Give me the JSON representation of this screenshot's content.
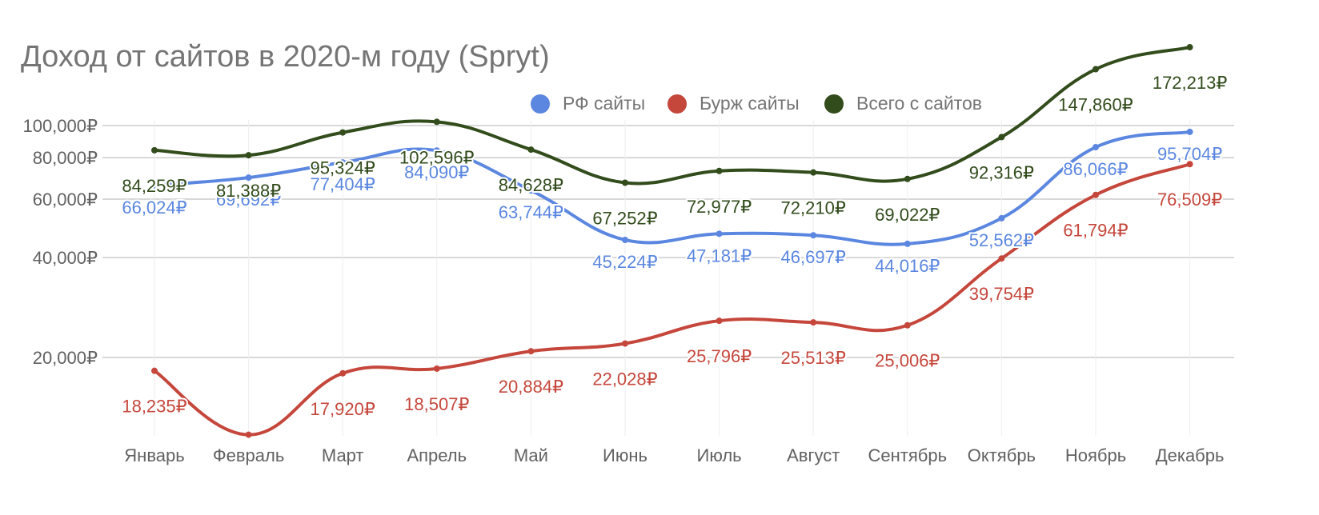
{
  "title": "Доход от сайтов в 2020-м году (Spryt)",
  "chart_data": {
    "type": "line",
    "categories": [
      "Январь",
      "Февраль",
      "Март",
      "Апрель",
      "Май",
      "Июнь",
      "Июль",
      "Август",
      "Сентябрь",
      "Октябрь",
      "Ноябрь",
      "Декабрь"
    ],
    "y_scale": "log",
    "y_ticks": [
      20000,
      40000,
      60000,
      80000,
      100000
    ],
    "y_tick_labels": [
      "20,000₽",
      "40,000₽",
      "60,000₽",
      "80,000₽",
      "100,000₽"
    ],
    "ylim": [
      15000,
      172213
    ],
    "grid": true,
    "legend_position": "top",
    "series": [
      {
        "name": "РФ сайты",
        "color": "#5b87e0",
        "values": [
          66024,
          69692,
          77404,
          84090,
          63744,
          45224,
          47181,
          46697,
          44016,
          52562,
          86066,
          95704
        ],
        "labels": [
          "66,024₽",
          "69,692₽",
          "77,404₽",
          "84,090₽",
          "63,744₽",
          "45,224₽",
          "47,181₽",
          "46,697₽",
          "44,016₽",
          "52,562₽",
          "86,066₽",
          "95,704₽"
        ]
      },
      {
        "name": "Бурж сайты",
        "color": "#c5473c",
        "values": [
          18235,
          11700,
          17920,
          18507,
          20884,
          22028,
          25796,
          25513,
          25006,
          39754,
          61794,
          76509
        ],
        "labels": [
          "18,235₽",
          "",
          "17,920₽",
          "18,507₽",
          "20,884₽",
          "22,028₽",
          "25,796₽",
          "25,513₽",
          "25,006₽",
          "39,754₽",
          "61,794₽",
          "76,509₽"
        ]
      },
      {
        "name": "Всего с сайтов",
        "color": "#324c1c",
        "values": [
          84259,
          81388,
          95324,
          102596,
          84628,
          67252,
          72977,
          72210,
          69022,
          92316,
          147860,
          172213
        ],
        "labels": [
          "84,259₽",
          "81,388₽",
          "95,324₽",
          "102,596₽",
          "84,628₽",
          "67,252₽",
          "72,977₽",
          "72,210₽",
          "69,022₽",
          "92,316₽",
          "147,860₽",
          "172,213₽"
        ]
      }
    ]
  }
}
